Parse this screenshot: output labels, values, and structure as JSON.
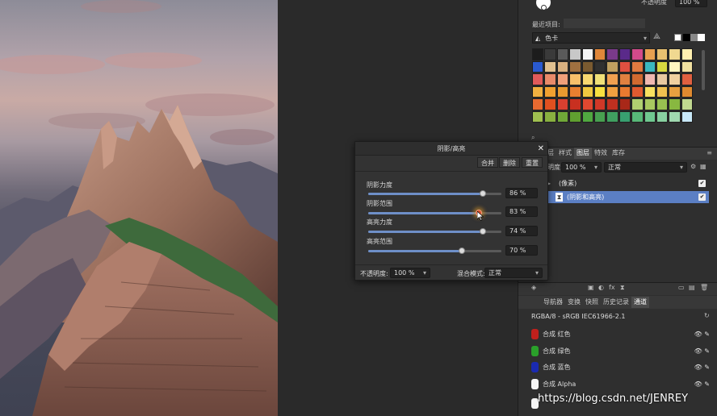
{
  "top_panel": {
    "opacity_label": "不透明度",
    "opacity_value": "100 %"
  },
  "recent": {
    "label": "最近项目:"
  },
  "palette": {
    "name": "色卡"
  },
  "swatch_colors": [
    "#1c1c1c",
    "#3a3a3a",
    "#5a5a5a",
    "#c8c8c8",
    "#f5f5f5",
    "#e0873a",
    "#7a3a8a",
    "#5a2a8a",
    "#d24a8a",
    "#e8a050",
    "#e8c070",
    "#f0d890",
    "#fff0b0",
    "#2a5ad0",
    "#e0c090",
    "#d8b080",
    "#a07040",
    "#7a5a30",
    "#303030",
    "#c0a060",
    "#e05040",
    "#e07a40",
    "#3ab8c0",
    "#d8d840",
    "#fff5c0",
    "#f0e0a0",
    "#e05a5a",
    "#e88a6a",
    "#f0a07a",
    "#f8c06a",
    "#f8d870",
    "#f0e078",
    "#f0a050",
    "#e08040",
    "#d06a30",
    "#f0b8b0",
    "#e8c8a0",
    "#f0d0a0",
    "#e06040",
    "#f0b040",
    "#f0a030",
    "#e89a30",
    "#e88030",
    "#f0c840",
    "#f8e040",
    "#f0a040",
    "#e87a30",
    "#e05a30",
    "#f8e060",
    "#f0c050",
    "#e8a040",
    "#e08a30",
    "#e86a30",
    "#e05020",
    "#d84030",
    "#c83020",
    "#e04830",
    "#d03828",
    "#c03020",
    "#a82818",
    "#b0d070",
    "#a8c860",
    "#98c050",
    "#88b840",
    "#c0d890",
    "#a0c050",
    "#88b040",
    "#70a838",
    "#60a030",
    "#50a840",
    "#48a050",
    "#40a060",
    "#38a070",
    "#58b878",
    "#70c890",
    "#88d0a0",
    "#a0d8b0",
    "#c8e8f8"
  ],
  "layers_tabs": [
    "层",
    "样式",
    "图层",
    "特效",
    "库存"
  ],
  "layers_tab_active": "图层",
  "layer_controls": {
    "opacity_prefix": "明度:",
    "opacity_value": "100 %",
    "blend_mode": "正常"
  },
  "layers": [
    {
      "name": "(像素)",
      "checked": true
    },
    {
      "name": "(阴影和高亮)",
      "checked": true
    }
  ],
  "bottom_tabs": [
    "导航器",
    "变换",
    "快照",
    "历史记录",
    "通道"
  ],
  "bottom_tab_active": "通道",
  "channels_format": "RGBA/8 - sRGB IEC61966-2.1",
  "channels": [
    {
      "name": "合成 红色",
      "color": "#c0201c"
    },
    {
      "name": "合成 绿色",
      "color": "#2aa02a"
    },
    {
      "name": "合成 蓝色",
      "color": "#1a2ab0"
    },
    {
      "name": "合成 Alpha",
      "color": "#f5f5f5"
    }
  ],
  "dialog": {
    "title": "阴影/高亮",
    "buttons": {
      "merge": "合并",
      "delete": "删除",
      "reset": "重置"
    },
    "sliders": [
      {
        "label": "阴影力度",
        "value": "86 %",
        "level": 0.86
      },
      {
        "label": "阴影范围",
        "value": "83 %",
        "level": 0.83
      },
      {
        "label": "高亮力度",
        "value": "74 %",
        "level": 0.86
      },
      {
        "label": "高亮范围",
        "value": "70 %",
        "level": 0.7
      }
    ],
    "opacity_label": "不透明度:",
    "opacity_value": "100 %",
    "blend_label": "混合模式:",
    "blend_value": "正常"
  },
  "watermark": "https://blog.csdn.net/JENREY"
}
